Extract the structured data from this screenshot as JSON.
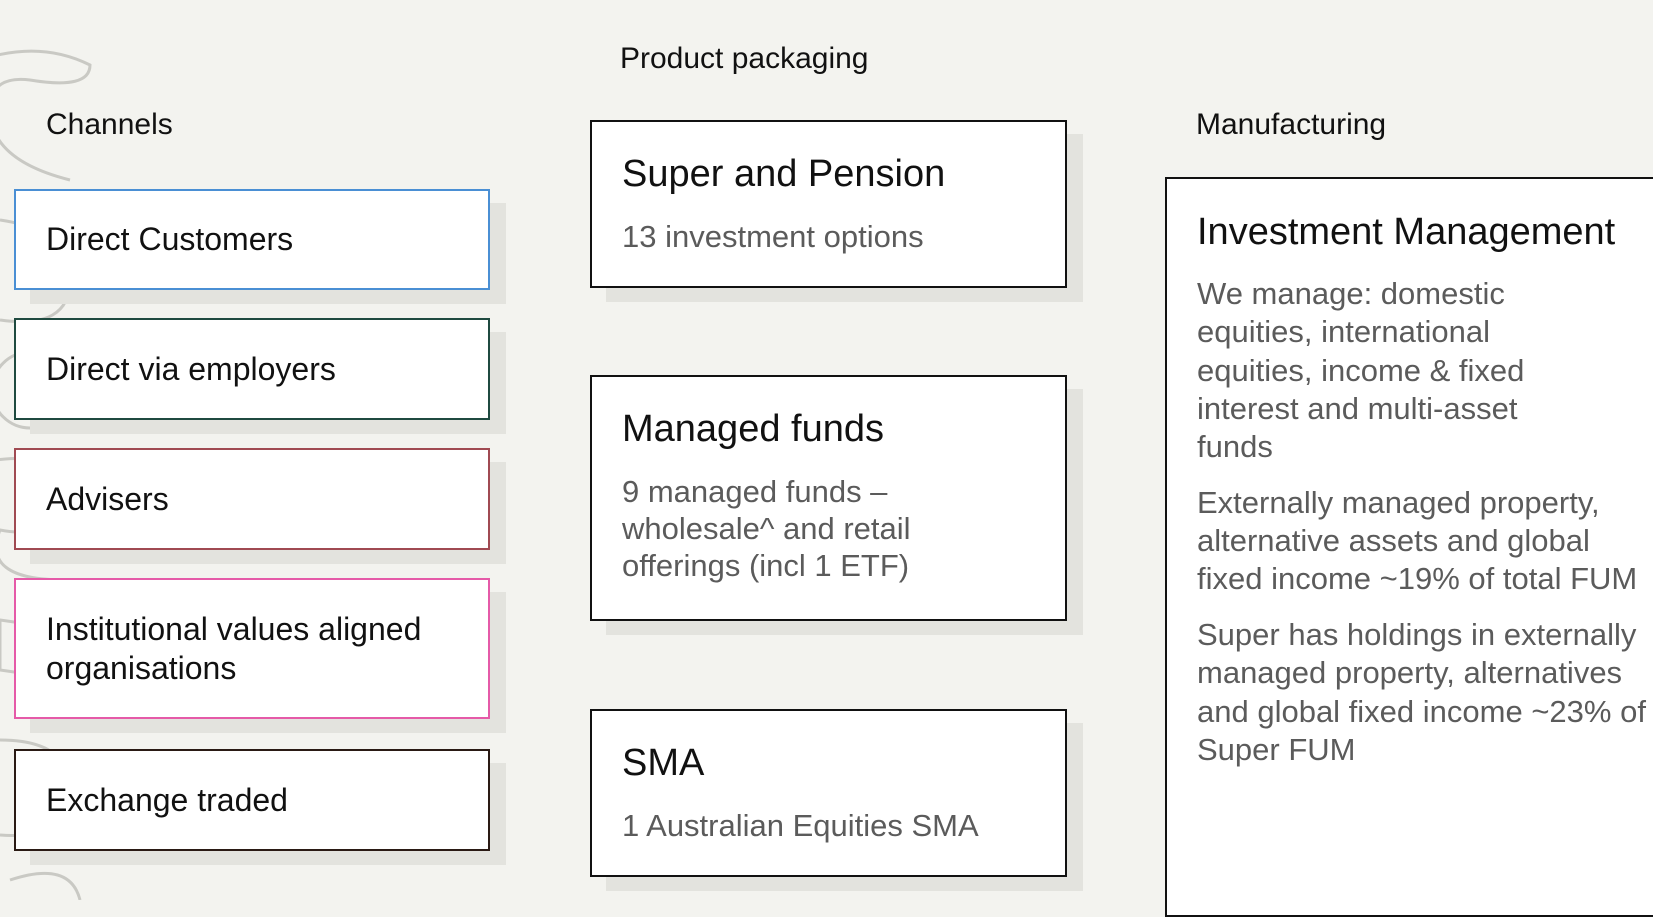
{
  "headings": {
    "channels": "Channels",
    "product_packaging": "Product packaging",
    "manufacturing": "Manufacturing"
  },
  "channels": [
    {
      "label": "Direct Customers",
      "color": "#4a8fd4"
    },
    {
      "label": "Direct via employers",
      "color": "#1f4a40"
    },
    {
      "label": "Advisers",
      "color": "#a04a52"
    },
    {
      "label": "Institutional values aligned organisations",
      "color": "#e55aa8"
    },
    {
      "label": "Exchange traded",
      "color": "#2a1a14"
    }
  ],
  "products": [
    {
      "title": "Super and Pension",
      "description": "13 investment options"
    },
    {
      "title": "Managed funds",
      "description": "9 managed funds – wholesale^ and retail offerings (incl 1 ETF)"
    },
    {
      "title": "SMA",
      "description": "1 Australian Equities SMA"
    }
  ],
  "manufacturing": {
    "title": "Investment Management",
    "paragraphs": [
      "We manage: domestic equities, international equities, income & fixed interest and multi-asset funds",
      "Externally managed property, alternative assets and global fixed income ~19% of total FUM",
      "Super has holdings in externally managed property, alternatives and global fixed income ~23% of Super FUM"
    ]
  },
  "colors": {
    "background": "#f3f3ef",
    "box_border": "#111111",
    "box_shadow": "#e3e3de",
    "description_text": "#5b5b5b",
    "watermark_stroke": "#c9c9c4"
  }
}
